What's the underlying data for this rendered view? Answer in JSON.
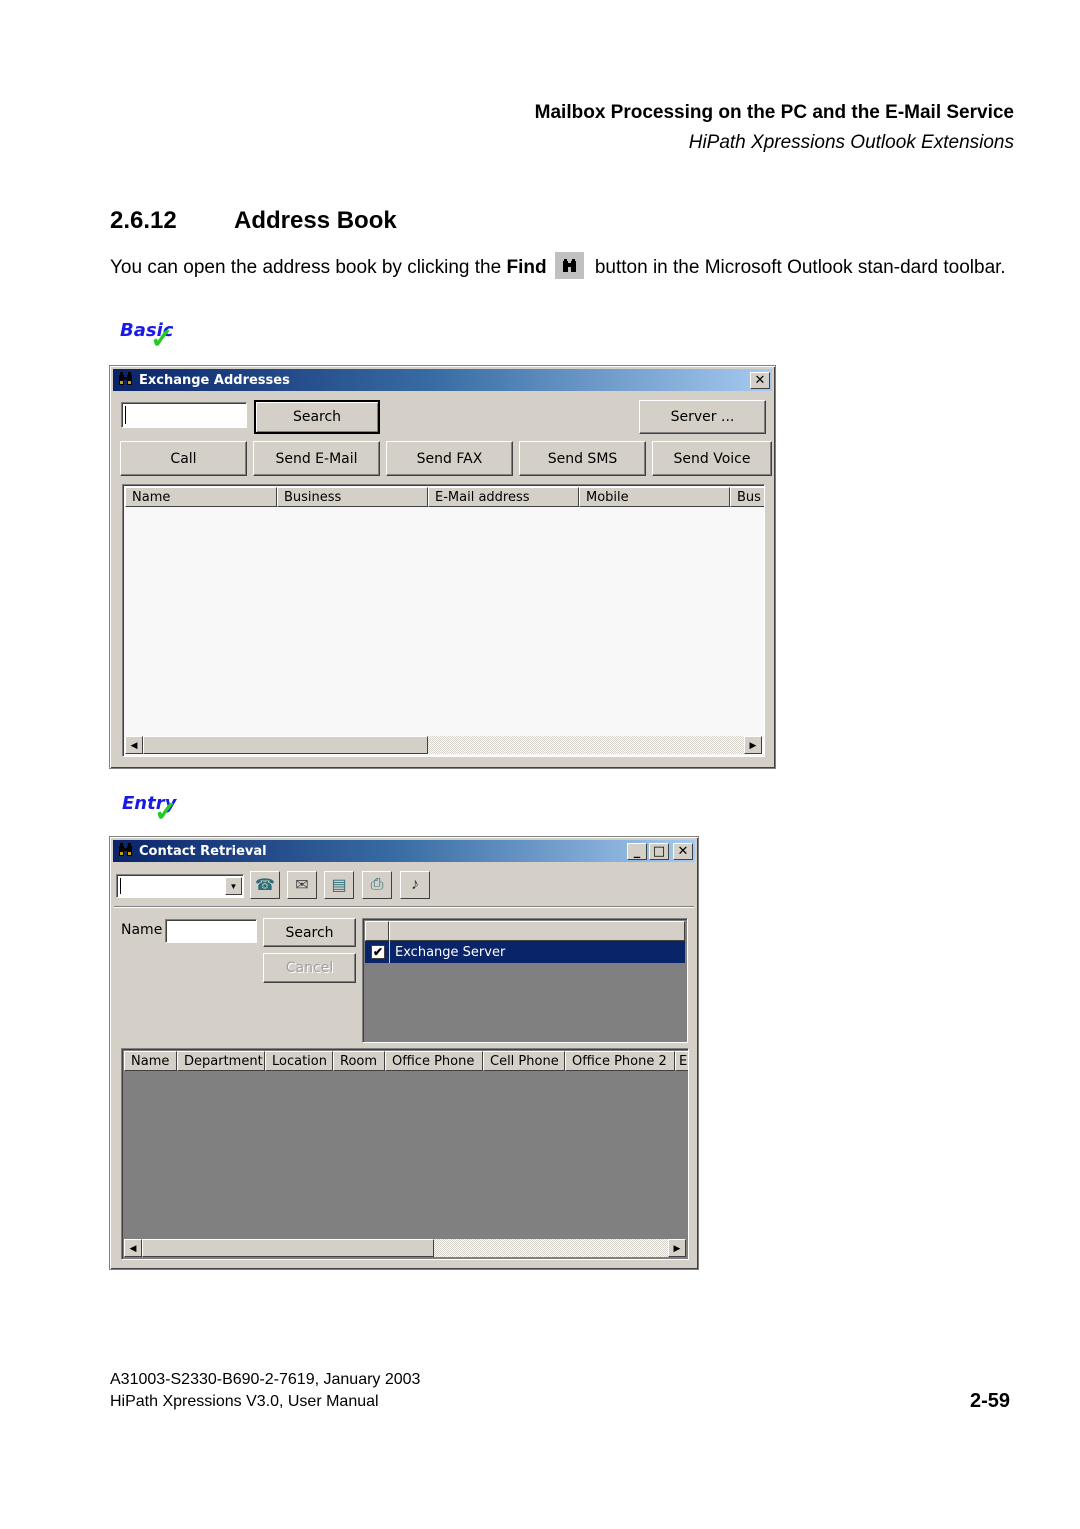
{
  "header": {
    "title": "Mailbox Processing on the PC and the E-Mail Service",
    "subtitle": "HiPath Xpressions Outlook Extensions"
  },
  "section": {
    "number": "2.6.12",
    "title": "Address Book"
  },
  "paragraph": {
    "before": "You can open the address book by clicking the ",
    "bold": "Find",
    "after": " button in the Microsoft Outlook stan-dard toolbar.",
    "icon": "binoculars-icon"
  },
  "badges": {
    "basic": "Basic",
    "entry": "Entry"
  },
  "exchange_dialog": {
    "title": "Exchange Addresses",
    "title_icon": "binoculars-icon",
    "close_label": "✕",
    "search_value": "",
    "search_button": "Search",
    "server_button": "Server ...",
    "action_buttons": [
      "Call",
      "Send E-Mail",
      "Send FAX",
      "Send SMS",
      "Send Voice"
    ],
    "columns": [
      "Name",
      "Business",
      "E-Mail address",
      "Mobile",
      "Bus"
    ],
    "rows": [],
    "scroll_left": "◀",
    "scroll_right": "▶",
    "colors": {
      "list_bg": "#f8f8f8",
      "dialog_bg": "#d4d0c8"
    }
  },
  "contact_dialog": {
    "title": "Contact Retrieval",
    "title_icon": "binoculars-icon",
    "minimize_label": "_",
    "maximize_label": "□",
    "close_label": "✕",
    "combo_value": "",
    "toolbar_icons": [
      "phone-handset-icon",
      "email-envelope-icon",
      "mobile-sms-icon",
      "fax-icon",
      "voice-icon"
    ],
    "toolbar_glyphs": [
      "☎",
      "✉",
      "▤",
      "⎙",
      "♪"
    ],
    "name_label": "Name",
    "name_value": "",
    "search_button": "Search",
    "cancel_button": "Cancel",
    "servers": [
      {
        "checked": true,
        "label": "Exchange Server",
        "selected": true
      }
    ],
    "columns": [
      "Name",
      "Department",
      "Location",
      "Room",
      "Office Phone",
      "Cell Phone",
      "Office Phone 2",
      "E"
    ],
    "rows": [],
    "scroll_left": "◀",
    "scroll_right": "▶",
    "colors": {
      "list_bg": "#808080",
      "selected_bg": "#0a246a"
    }
  },
  "footer": {
    "doc_id": "A31003-S2330-B690-2-7619, January 2003",
    "manual": "HiPath Xpressions V3.0, User Manual",
    "page": "2-59"
  }
}
